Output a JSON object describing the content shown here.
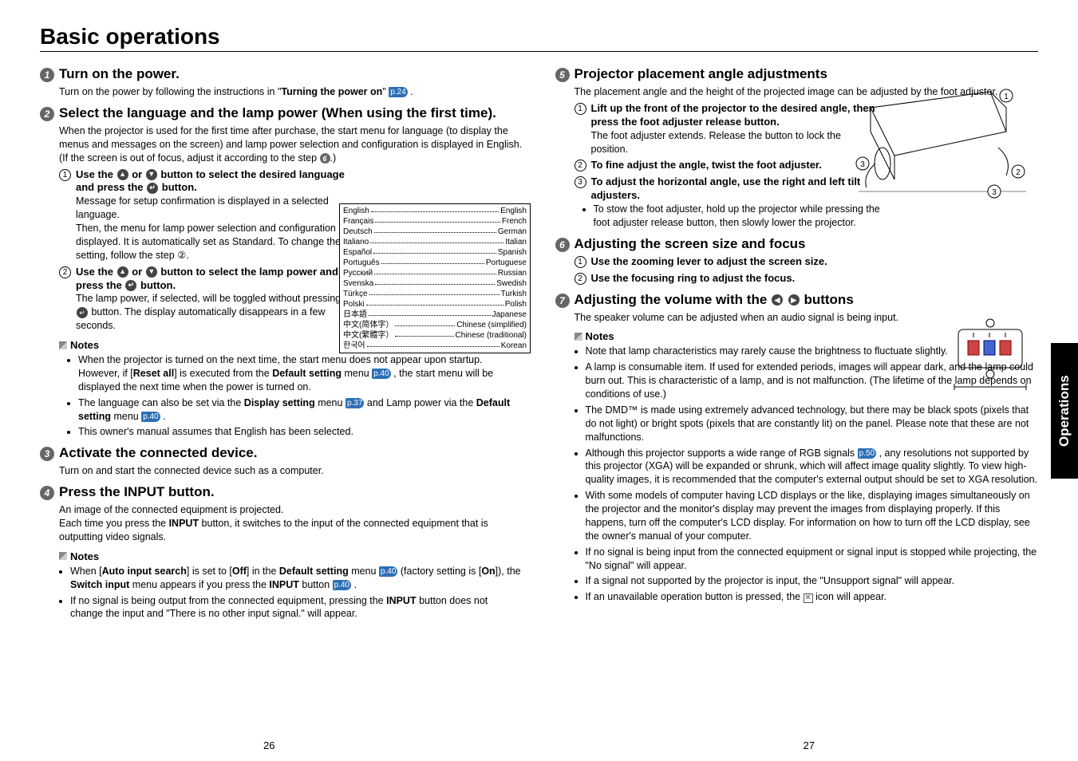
{
  "title": "Basic operations",
  "sideTab": "Operations",
  "pageLeft": "26",
  "pageRight": "27",
  "left": {
    "s1": {
      "num": "1",
      "title": "Turn on the power.",
      "text_a": "Turn on the power by following the instructions in \"",
      "text_b_bold": "Turning the power on",
      "text_c": "\" ",
      "pref": "p.24",
      "text_d": " ."
    },
    "s2": {
      "num": "2",
      "title": "Select the language and the lamp power (When using the first time).",
      "para": "When the projector is used for the first time after purchase, the start menu for language (to display the menus and messages on the screen) and lamp power selection and configuration is displayed in English. (If the screen is out of focus, adjust it according to the step ",
      "para_ref": "6",
      "para_end": ".)",
      "step1_num": "1",
      "step1_t1": "Use the ",
      "step1_t2": " or ",
      "step1_t3": " button to select the desired language and press the ",
      "step1_t4": " button.",
      "step1_body": "Message for setup confirmation is displayed in a selected language.",
      "step1_body2": "Then, the menu for lamp power selection and configuration is displayed. It is automatically set as Standard. To change the setting, follow the step ②.",
      "step2_num": "2",
      "step2_t1": "Use the ",
      "step2_t2": " or ",
      "step2_t3": " button to select the lamp power and press the ",
      "step2_t4": " button.",
      "step2_body_a": "The lamp power, if selected, will be toggled without pressing the ",
      "step2_body_b": " button. The display automatically disappears in a few seconds.",
      "notes_label": "Notes",
      "note1_a": "When the projector is turned on the next time, the start menu does not appear upon startup. However, if [",
      "note1_b_bold": "Reset all",
      "note1_c": "] is executed from the ",
      "note1_d_bold": "Default setting",
      "note1_e": " menu ",
      "note1_pref": "p.40",
      "note1_f": " , the start menu will be displayed the next time when the power is turned on.",
      "note2_a": "The language can also be set via the ",
      "note2_b_bold": "Display setting",
      "note2_c": " menu ",
      "note2_pref1": "p.37",
      "note2_d": " and Lamp power via the ",
      "note2_e_bold": "Default setting",
      "note2_f": " menu ",
      "note2_pref2": "p.40",
      "note2_g": " .",
      "note3": "This owner's manual assumes that English has been selected."
    },
    "s3": {
      "num": "3",
      "title": "Activate the connected device.",
      "text": "Turn on and start the connected device such as a computer."
    },
    "s4": {
      "num": "4",
      "title": "Press the INPUT button.",
      "text1": "An image of the connected equipment is projected.",
      "text2_a": "Each time you press the ",
      "text2_b_bold": "INPUT",
      "text2_c": " button, it switches to the input of the connected equipment that is outputting video signals.",
      "notes_label": "Notes",
      "note1_a": "When [",
      "note1_b_bold": "Auto input search",
      "note1_c": "] is set to [",
      "note1_d_bold": "Off",
      "note1_e": "] in the ",
      "note1_f_bold": "Default setting",
      "note1_g": " menu ",
      "note1_pref1": "p.40",
      "note1_h": " (factory setting is [",
      "note1_i_bold": "On",
      "note1_j": "]), the ",
      "note1_k_bold": "Switch input",
      "note1_l": " menu appears if you press the ",
      "note1_m_bold": "INPUT",
      "note1_n": " button ",
      "note1_pref2": "p.40",
      "note1_o": " .",
      "note2_a": "If no signal is being output from the connected equipment, pressing the ",
      "note2_b_bold": "INPUT",
      "note2_c": " button does not change the input and \"There is no other input signal.\" will appear."
    }
  },
  "langs": [
    {
      "l": "English",
      "r": "English"
    },
    {
      "l": "Français",
      "r": "French"
    },
    {
      "l": "Deutsch",
      "r": "German"
    },
    {
      "l": "Italiano",
      "r": "Italian"
    },
    {
      "l": "Español",
      "r": "Spanish"
    },
    {
      "l": "Português",
      "r": "Portuguese"
    },
    {
      "l": "Русский",
      "r": "Russian"
    },
    {
      "l": "Svenska",
      "r": "Swedish"
    },
    {
      "l": "Türkçe",
      "r": "Turkish"
    },
    {
      "l": "Polski",
      "r": "Polish"
    },
    {
      "l": "日本語",
      "r": "Japanese"
    },
    {
      "l": "中文(简体字）",
      "r": "Chinese (simplified)"
    },
    {
      "l": "中文(繁體字）",
      "r": "Chinese (traditional)"
    },
    {
      "l": "한국어",
      "r": "Korean"
    }
  ],
  "right": {
    "s5": {
      "num": "5",
      "title": "Projector placement angle adjustments",
      "text": "The placement angle and the height of the projected image can be adjusted by the foot adjuster.",
      "st1_num": "1",
      "st1_title": "Lift up the front of the projector to the desired angle, then press the foot adjuster release button.",
      "st1_body": "The foot adjuster extends. Release the button to lock the position.",
      "st2_num": "2",
      "st2_title": "To fine adjust the angle, twist the foot adjuster.",
      "st3_num": "3",
      "st3_title": "To adjust the horizontal angle, use the right and left tilt adjusters.",
      "bullet": "To stow the foot adjuster, hold up the projector while pressing the foot adjuster release button, then slowly lower the projector."
    },
    "s6": {
      "num": "6",
      "title": "Adjusting the screen size and focus",
      "st1_num": "1",
      "st1": "Use the zooming lever to adjust the screen size.",
      "st2_num": "2",
      "st2": "Use the focusing ring to adjust the focus."
    },
    "s7": {
      "num": "7",
      "title_a": "Adjusting the volume with the ",
      "title_b": " buttons",
      "text": "The speaker volume can be adjusted when an audio signal is being input.",
      "notes_label": "Notes",
      "n1": "Note that lamp characteristics may rarely cause the brightness to fluctuate slightly.",
      "n2": "A lamp is consumable item. If used for extended periods, images will appear dark, and the lamp could burn out.  This is characteristic of a lamp, and is not malfunction. (The lifetime of the lamp depends on conditions of use.)",
      "n3": "The DMD™ is made using extremely advanced technology, but there may be black spots (pixels that do not light) or bright spots (pixels that are constantly lit) on the panel.  Please note that these are not malfunctions.",
      "n4_a": "Although this projector supports a wide range of RGB signals ",
      "n4_pref": "p.50",
      "n4_b": " , any resolutions not supported by this projector (XGA) will be expanded or shrunk, which will affect image quality slightly. To view high-quality images, it is recommended that the computer's external output should be set to XGA resolution.",
      "n5": "With some models of computer having LCD displays or the like, displaying images simultaneously on the projector and the monitor's display may prevent the images from displaying properly. If this happens, turn off the computer's LCD display. For information on how to turn off the LCD display, see the owner's manual of your computer.",
      "n6": "If no signal is being input from the connected equipment or signal input is stopped while projecting, the \"No signal\" will appear.",
      "n7": "If a signal not supported by the projector is input, the \"Unsupport signal\" will appear.",
      "n8_a": "If an unavailable operation button is pressed, the ",
      "n8_b": " icon will appear."
    }
  }
}
